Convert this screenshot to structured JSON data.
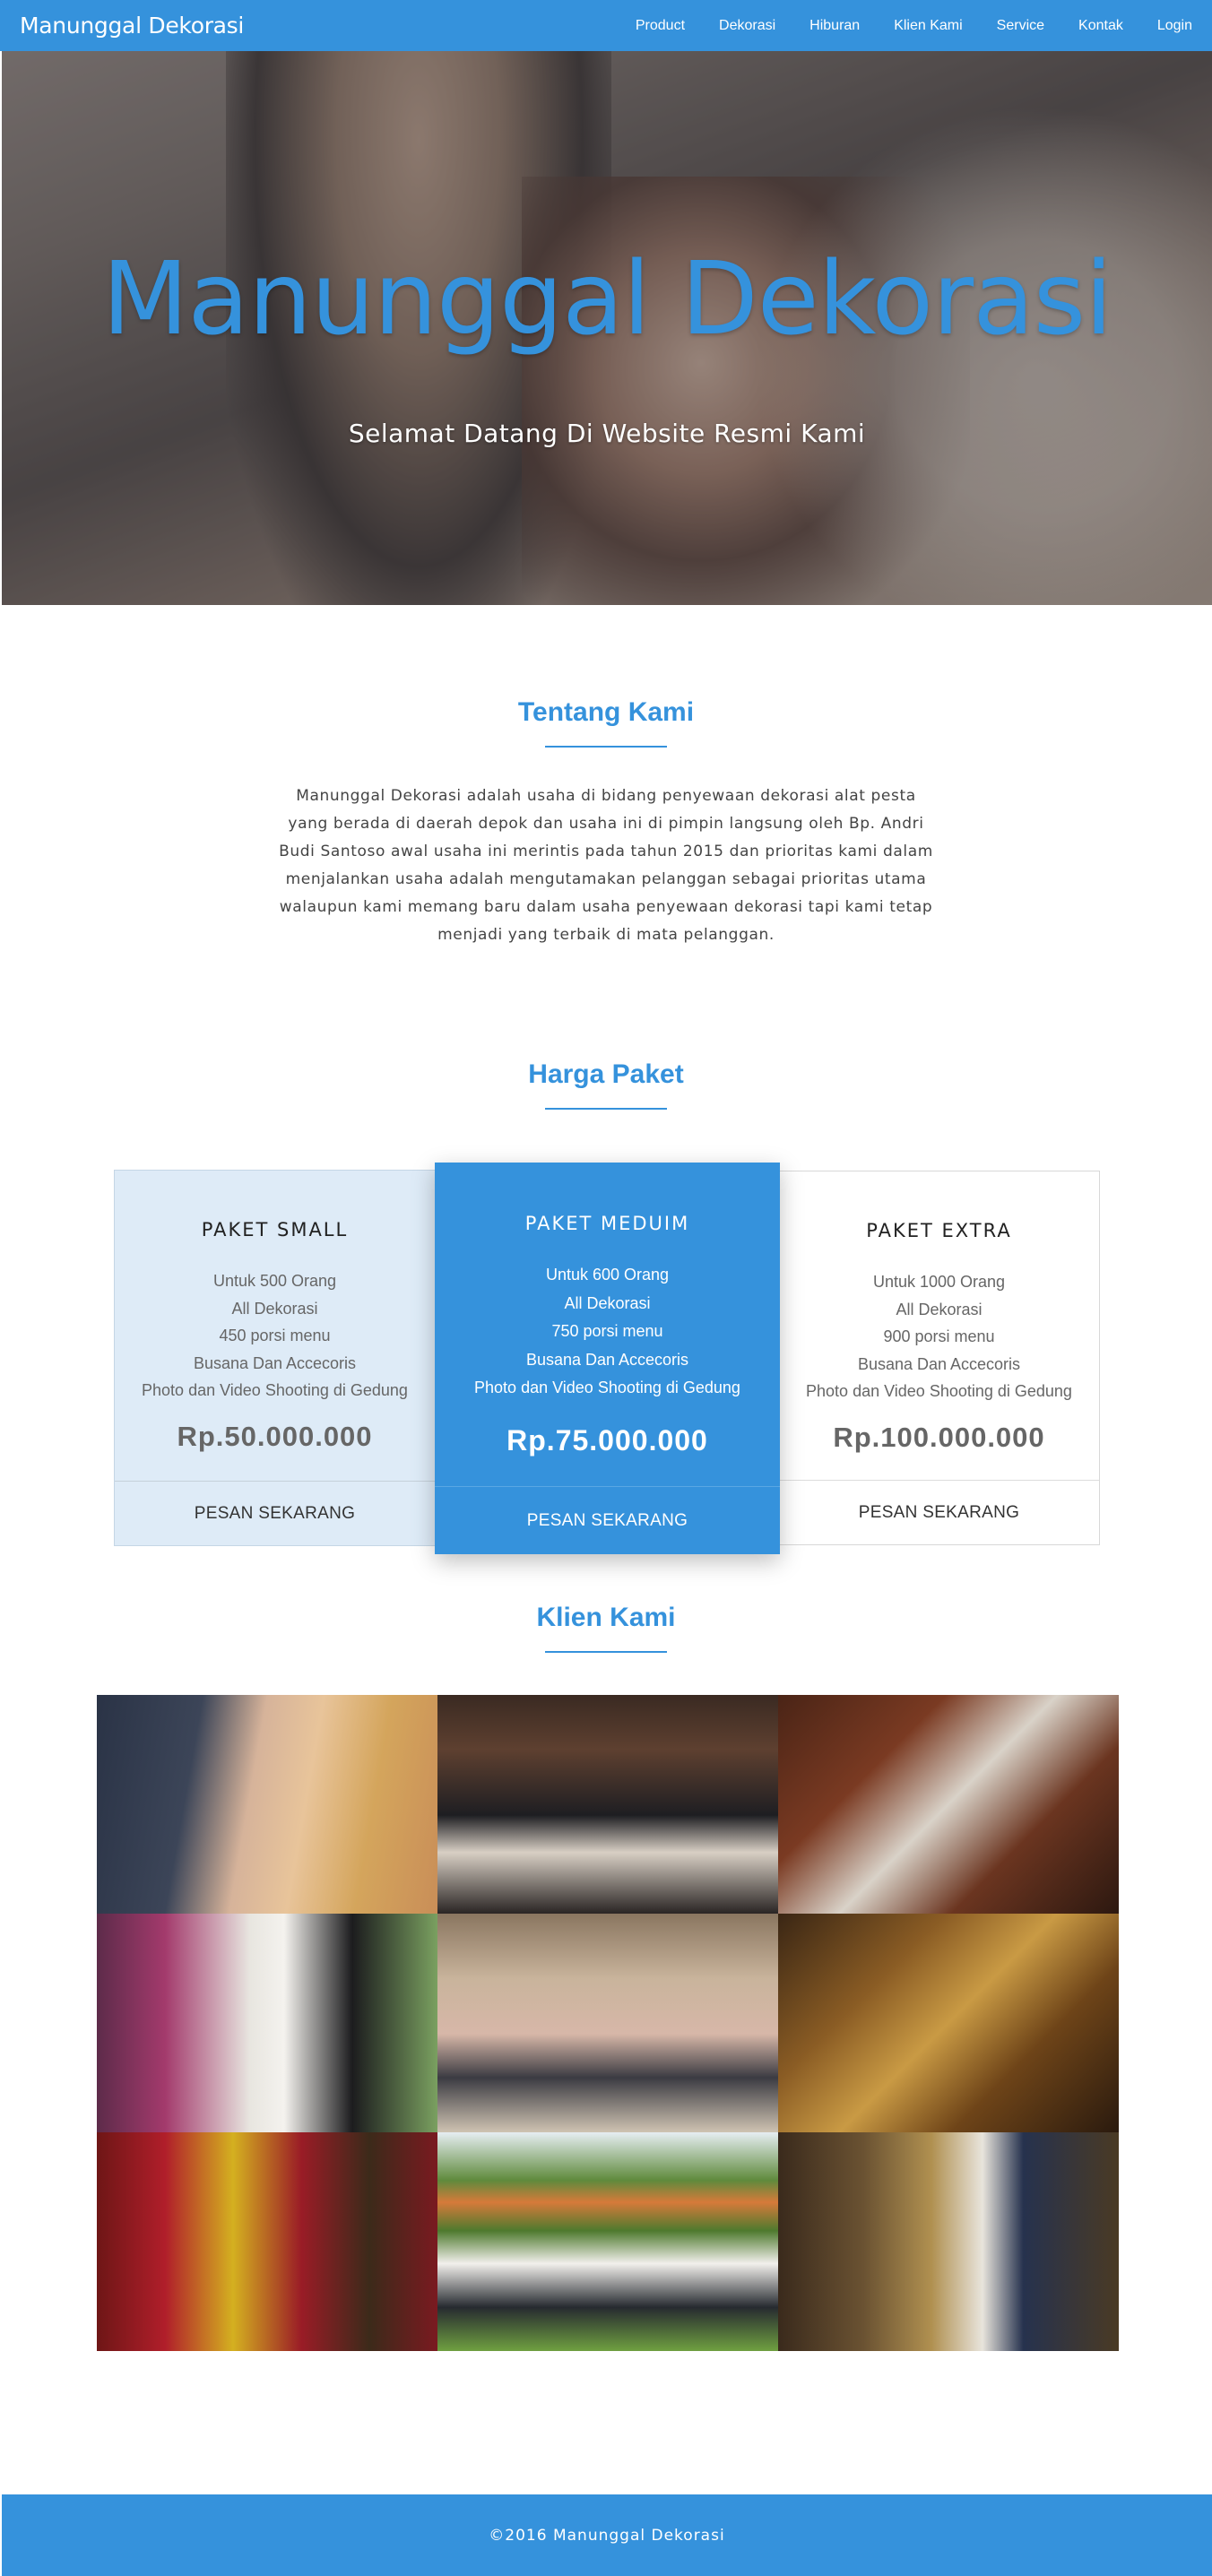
{
  "nav": {
    "brand": "Manunggal Dekorasi",
    "links": [
      "Product",
      "Dekorasi",
      "Hiburan",
      "Klien Kami",
      "Service",
      "Kontak",
      "Login"
    ]
  },
  "hero": {
    "title": "Manunggal Dekorasi",
    "subtitle": "Selamat Datang Di Website Resmi Kami"
  },
  "about": {
    "title": "Tentang Kami",
    "text": "Manunggal Dekorasi adalah usaha di bidang penyewaan dekorasi alat pesta yang berada di daerah depok dan usaha ini di pimpin langsung oleh Bp. Andri Budi Santoso awal usaha ini merintis pada tahun 2015 dan prioritas kami dalam menjalankan usaha adalah mengutamakan pelanggan sebagai prioritas utama walaupun kami memang baru dalam usaha penyewaan dekorasi tapi kami tetap menjadi yang terbaik di mata pelanggan."
  },
  "pricing": {
    "title": "Harga Paket",
    "plans": [
      {
        "name": "PAKET SMALL",
        "features": [
          "Untuk 500 Orang",
          "All Dekorasi",
          "450 porsi menu",
          "Busana Dan Accecoris",
          "Photo dan Video Shooting di Gedung"
        ],
        "price": "Rp.50.000.000",
        "cta": "PESAN SEKARANG"
      },
      {
        "name": "PAKET MEDUIM",
        "features": [
          "Untuk 600 Orang",
          "All Dekorasi",
          "750 porsi menu",
          "Busana Dan Accecoris",
          "Photo dan Video Shooting di Gedung"
        ],
        "price": "Rp.75.000.000",
        "cta": "PESAN SEKARANG"
      },
      {
        "name": "PAKET EXTRA",
        "features": [
          "Untuk 1000 Orang",
          "All Dekorasi",
          "900 porsi menu",
          "Busana Dan Accecoris",
          "Photo dan Video Shooting di Gedung"
        ],
        "price": "Rp.100.000.000",
        "cta": "PESAN SEKARANG"
      }
    ]
  },
  "clients": {
    "title": "Klien Kami"
  },
  "footer": {
    "text": "©2016 Manunggal Dekorasi"
  },
  "colors": {
    "accent": "#3592dc",
    "small_plan_bg": "#deebf7"
  }
}
